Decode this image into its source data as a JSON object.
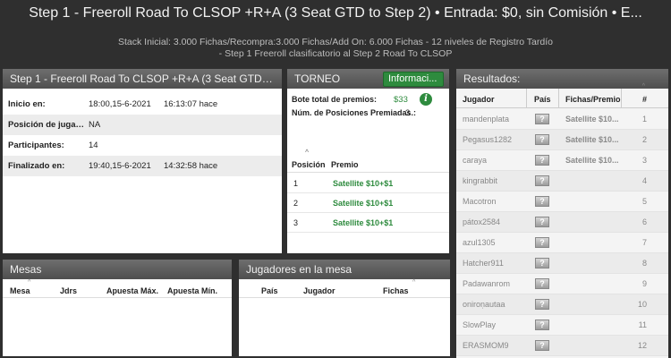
{
  "header": {
    "title": "Step 1 - Freeroll Road To CLSOP +R+A (3 Seat GTD to Step 2) • Entrada: $0, sin Comisión • E...",
    "subtitle1": "Stack Inicial: 3.000 Fichas/Recompra:3.000 Fichas/Add On: 6.000 Fichas -  12 niveles de Registro Tardío",
    "subtitle2": "- Step 1 Freeroll clasificatorio al Step 2 Road To CLSOP"
  },
  "details": {
    "title": "Step 1 - Freeroll Road To CLSOP +R+A (3 Seat GTD to St...",
    "rows": [
      {
        "label": "Inicio en:",
        "value": "18:00,15-6-2021",
        "extra": "16:13:07 hace"
      },
      {
        "label": "Posición de jugado...",
        "value": "NA",
        "extra": ""
      },
      {
        "label": "Participantes:",
        "value": "14",
        "extra": ""
      },
      {
        "label": "Finalizado en:",
        "value": "19:40,15-6-2021",
        "extra": "14:32:58 hace"
      }
    ]
  },
  "torneo": {
    "title": "TORNEO",
    "info_button": "Informaci...",
    "prize_label": "Bote total de premios:",
    "prize_value": "$33",
    "positions_label": "Núm. de Posiciones Premiadas.:",
    "positions_value": "3",
    "col_pos": "Posición",
    "col_prize": "Premio",
    "prizes": [
      {
        "pos": "1",
        "prize": "Satellite $10+$1"
      },
      {
        "pos": "2",
        "prize": "Satellite $10+$1"
      },
      {
        "pos": "3",
        "prize": "Satellite $10+$1"
      }
    ]
  },
  "mesas": {
    "title": "Mesas",
    "cols": [
      "Mesa",
      "Jdrs",
      "Apuesta Máx.",
      "Apuesta Mín."
    ]
  },
  "jugadores_mesa": {
    "title": "Jugadores en la mesa",
    "cols": [
      "País",
      "Jugador",
      "Fichas"
    ]
  },
  "results": {
    "title": "Resultados:",
    "cols": [
      "Jugador",
      "País",
      "Fichas/Premio",
      "#"
    ],
    "rows": [
      {
        "name": "mandenplata",
        "prize": "Satellite $10...",
        "rank": "1"
      },
      {
        "name": "Pegasus1282",
        "prize": "Satellite $10...",
        "rank": "2"
      },
      {
        "name": "caraya",
        "prize": "Satellite $10...",
        "rank": "3"
      },
      {
        "name": "kingrabbit",
        "prize": "",
        "rank": "4"
      },
      {
        "name": "Macotron",
        "prize": "",
        "rank": "5"
      },
      {
        "name": "pátox2584",
        "prize": "",
        "rank": "6"
      },
      {
        "name": "azul1305",
        "prize": "",
        "rank": "7"
      },
      {
        "name": "Hatcher911",
        "prize": "",
        "rank": "8"
      },
      {
        "name": "Padawanrom",
        "prize": "",
        "rank": "9"
      },
      {
        "name": "oniroṇautaa",
        "prize": "",
        "rank": "10"
      },
      {
        "name": "SlowPlay",
        "prize": "",
        "rank": "11"
      },
      {
        "name": "ERASMOM9",
        "prize": "",
        "rank": "12"
      }
    ],
    "country_icon": "?"
  },
  "colors": {
    "accent_green": "#2e8b3e",
    "header_bg": "#4f4f4f",
    "page_bg": "#2f2f2f"
  }
}
